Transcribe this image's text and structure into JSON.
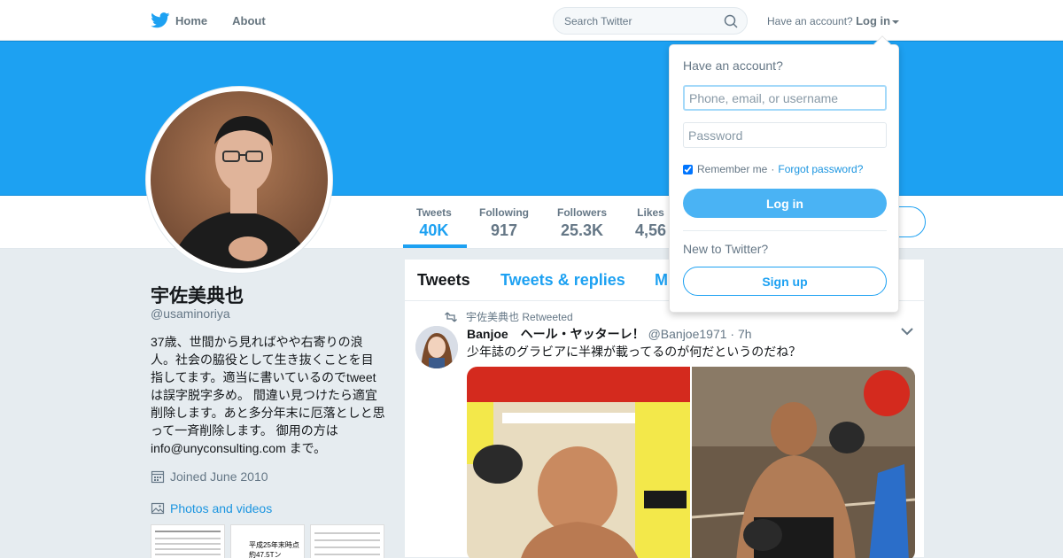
{
  "nav": {
    "home": "Home",
    "about": "About",
    "search_placeholder": "Search Twitter",
    "have_account": "Have an account?",
    "login": "Log in"
  },
  "colors": {
    "brand": "#1da1f2",
    "cover": "#1da1f2",
    "login_button": "#4ab3f4"
  },
  "stats": [
    {
      "label": "Tweets",
      "value": "40K"
    },
    {
      "label": "Following",
      "value": "917"
    },
    {
      "label": "Followers",
      "value": "25.3K"
    },
    {
      "label": "Likes",
      "value": "4,56"
    }
  ],
  "profile": {
    "name": "宇佐美典也",
    "handle": "@usaminoriya",
    "bio": "37歳、世間から見ればやや右寄りの浪人。社会の脇役として生き抜くことを目指してます。適当に書いているのでtweetは誤字脱字多め。 間違い見つけたら適宜削除します。あと多分年末に厄落としと思って一斉削除します。 御用の方はinfo@unyconsulting.com まで。",
    "joined": "Joined June 2010",
    "photos_link": "Photos and videos",
    "thumb_texts": [
      "平成25年末時点",
      "約47.5Tン"
    ]
  },
  "timeline": {
    "tabs": [
      "Tweets",
      "Tweets & replies",
      "M"
    ],
    "retweet_label": "宇佐美典也 Retweeted",
    "tweet": {
      "author": "Banjoe　ヘール・ヤッターレ！",
      "handle": "@Banjoe1971",
      "time": "7h",
      "text": "少年誌のグラビアに半裸が載ってるのが何だというのだね？"
    }
  },
  "dropdown": {
    "title": "Have an account?",
    "user_placeholder": "Phone, email, or username",
    "password_placeholder": "Password",
    "remember": "Remember me",
    "separator": "·",
    "forgot": "Forgot password?",
    "login_button": "Log in",
    "new_to": "New to Twitter?",
    "signup_button": "Sign up"
  }
}
